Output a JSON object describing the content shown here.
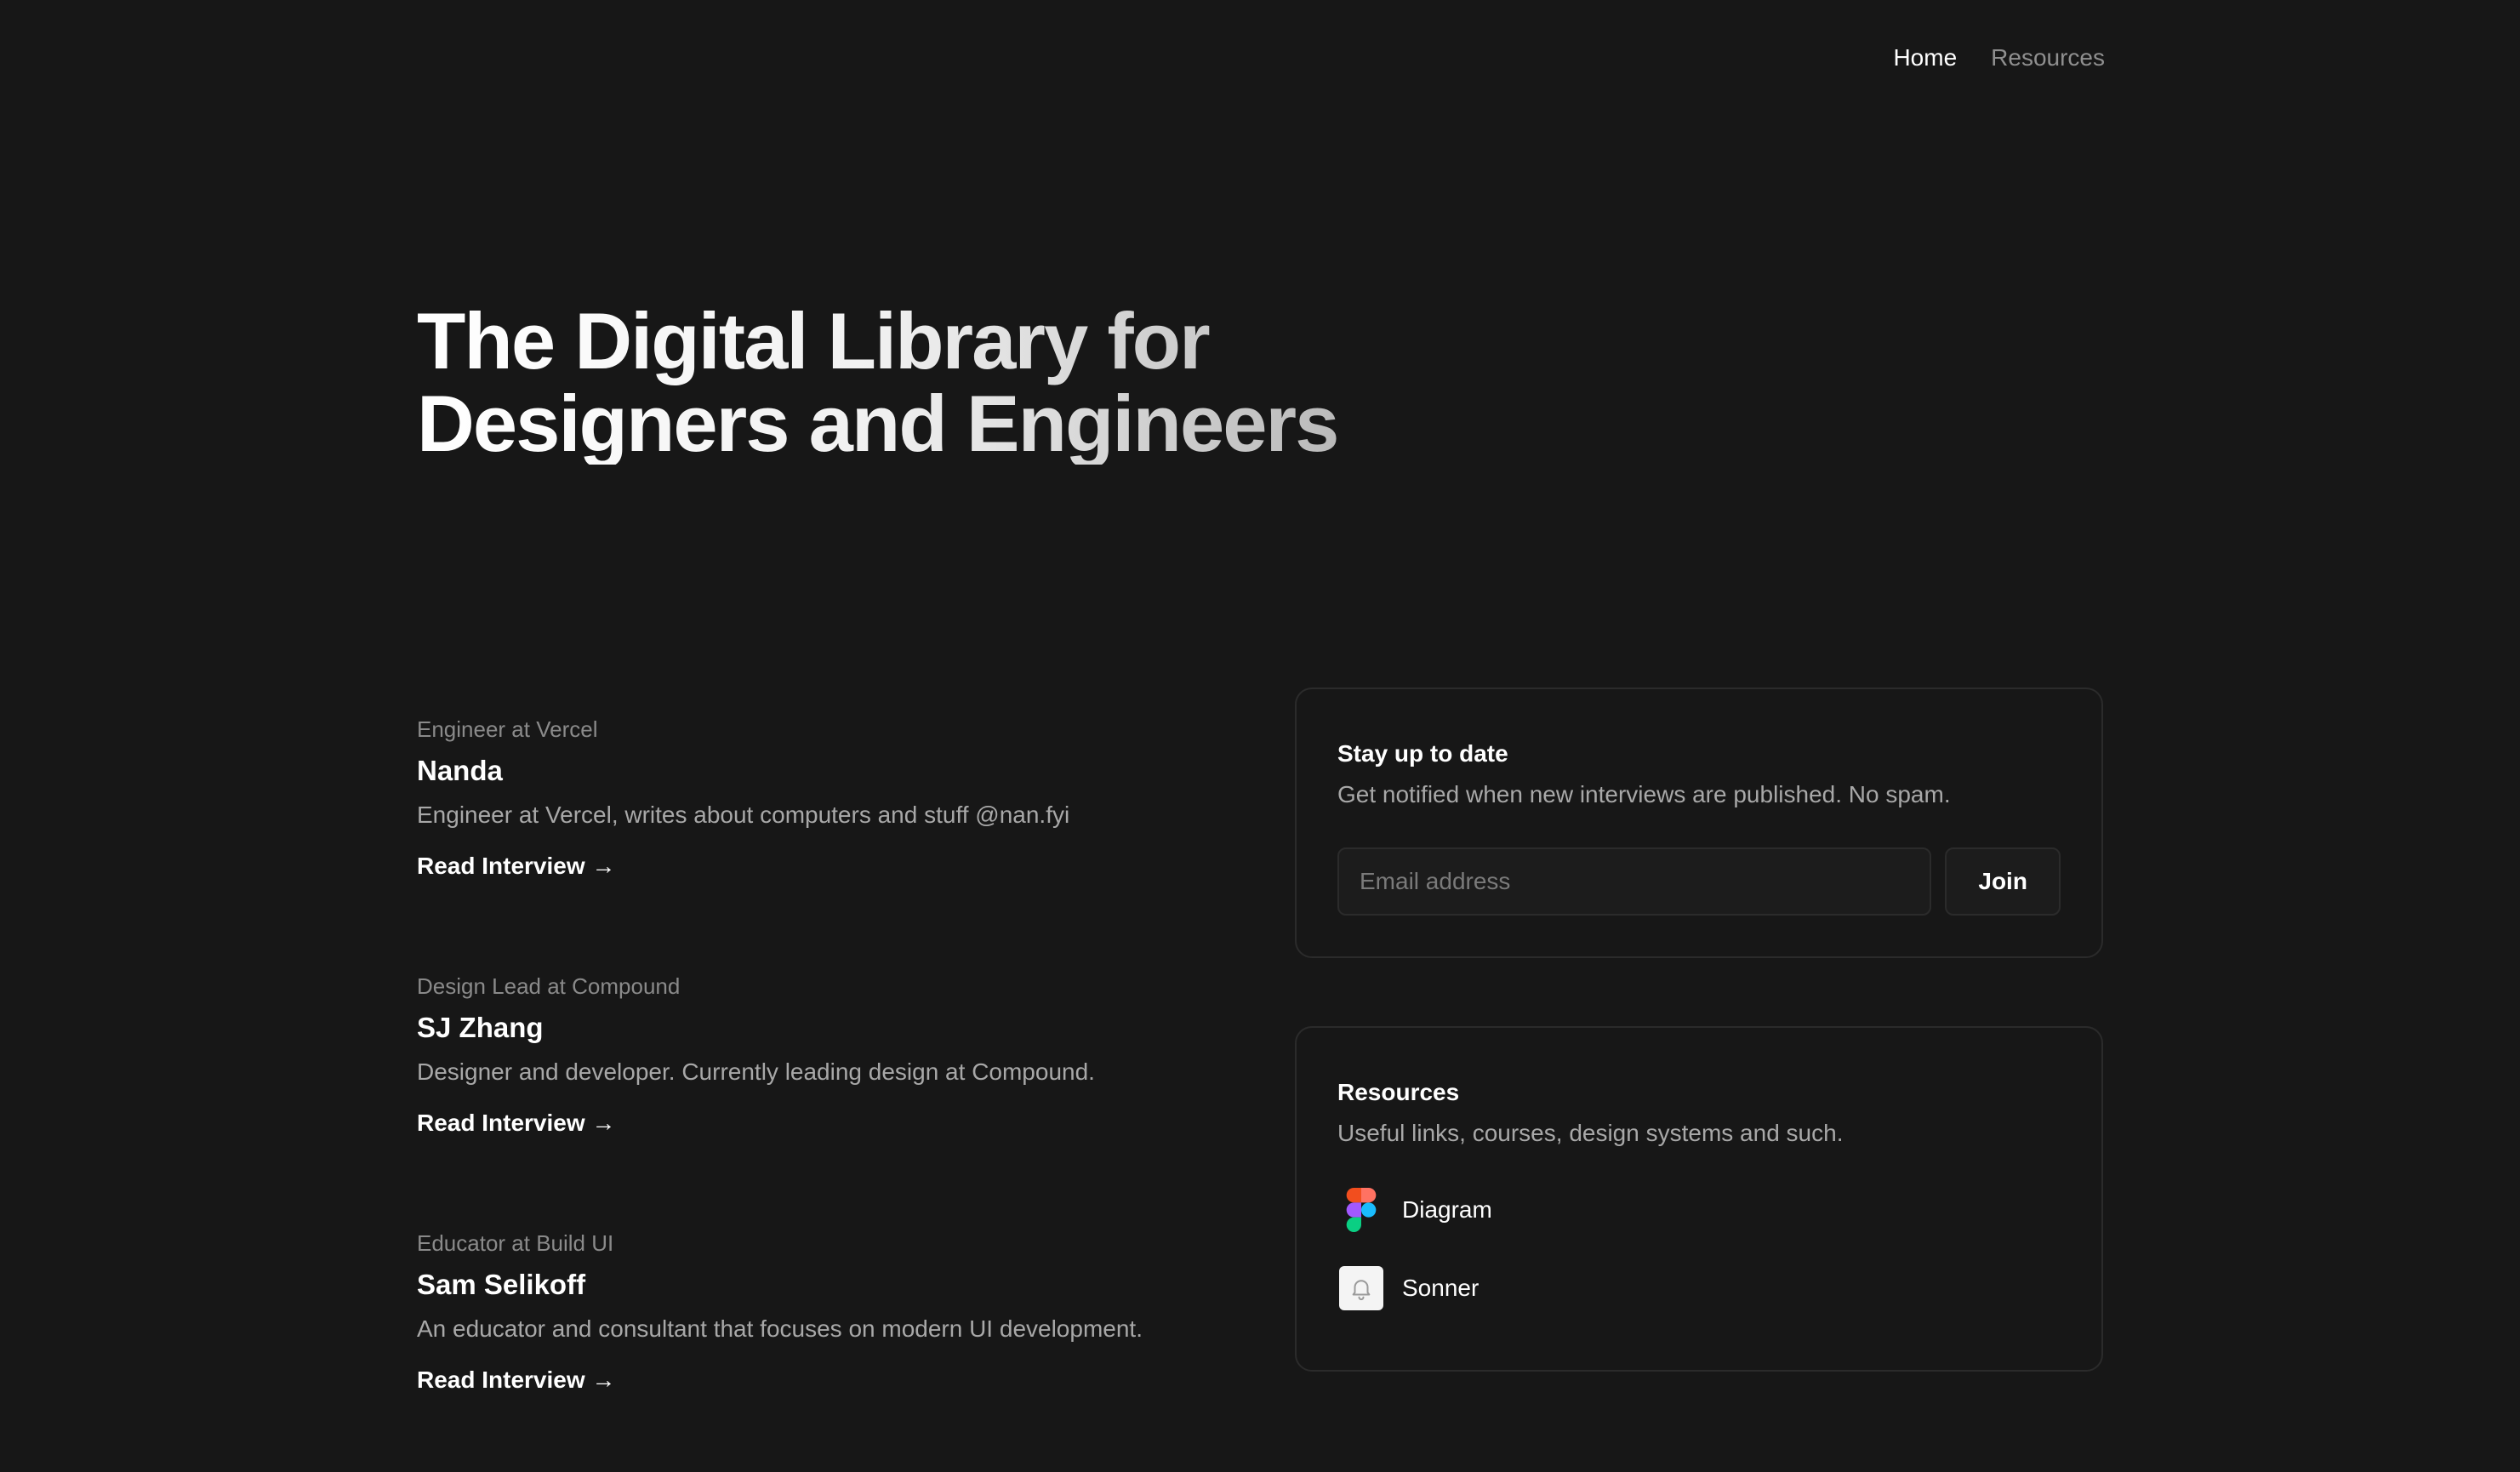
{
  "nav": {
    "items": [
      {
        "label": "Home",
        "active": true
      },
      {
        "label": "Resources",
        "active": false
      }
    ]
  },
  "hero": {
    "line1": "The Digital Library for",
    "line2": "Designers and Engineers"
  },
  "interviews": [
    {
      "role": "Engineer at Vercel",
      "name": "Nanda",
      "bio": "Engineer at Vercel, writes about computers and stuff @nan.fyi",
      "link": "Read Interview →"
    },
    {
      "role": "Design Lead at Compound",
      "name": "SJ Zhang",
      "bio": "Designer and developer. Currently leading design at Compound.",
      "link": "Read Interview →"
    },
    {
      "role": "Educator at Build UI",
      "name": "Sam Selikoff",
      "bio": "An educator and consultant that focuses on modern UI development.",
      "link": "Read Interview →"
    }
  ],
  "newsletter": {
    "title": "Stay up to date",
    "description": "Get notified when new interviews are published. No spam.",
    "email_placeholder": "Email address",
    "join_label": "Join"
  },
  "resources": {
    "title": "Resources",
    "description": "Useful links, courses, design systems and such.",
    "items": [
      {
        "label": "Diagram",
        "icon": "figma-icon"
      },
      {
        "label": "Sonner",
        "icon": "bell-icon"
      }
    ]
  },
  "colors": {
    "background": "#171717",
    "text_primary": "#ffffff",
    "text_muted": "#8a8a8a",
    "border": "#2b2b2b"
  }
}
